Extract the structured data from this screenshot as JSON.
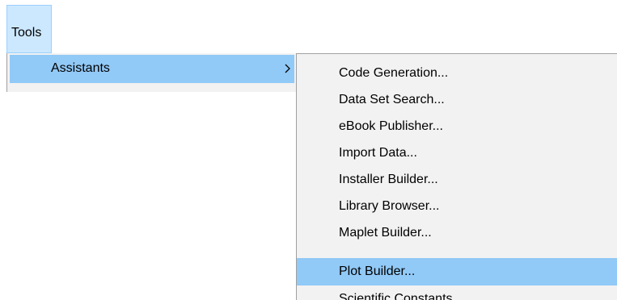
{
  "menubar": {
    "tools_label": "Tools"
  },
  "tools_menu": {
    "assistants_label": "Assistants",
    "submenu_arrow_icon": "chevron-right-icon"
  },
  "assistants_menu": {
    "items": [
      {
        "label": "Code Generation..."
      },
      {
        "label": "Data Set Search..."
      },
      {
        "label": "eBook Publisher..."
      },
      {
        "label": "Import Data..."
      },
      {
        "label": "Installer Builder..."
      },
      {
        "label": "Library Browser..."
      },
      {
        "label": "Maplet Builder..."
      },
      {
        "label": "Plot Builder..."
      },
      {
        "label": "Scientific Constants..."
      }
    ],
    "selected_label": "Plot Builder..."
  },
  "colors": {
    "menubar_active_bg": "#cce8ff",
    "menubar_active_border": "#99d1ff",
    "menu_bg": "#f2f2f2",
    "highlight": "#91c9f7",
    "menu_border": "#a0a0a0"
  }
}
